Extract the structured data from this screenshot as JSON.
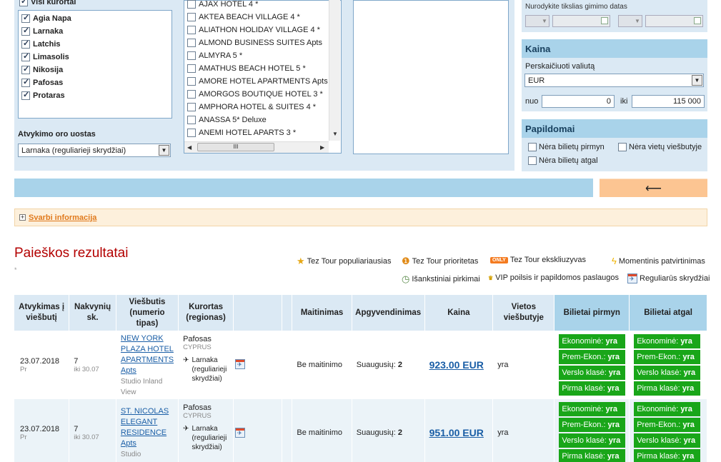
{
  "filters": {
    "all_resorts_label": "Visi kurortai",
    "resorts": [
      "Agia Napa",
      "Larnaka",
      "Latchis",
      "Limasolis",
      "Nikosija",
      "Pafosas",
      "Protaras"
    ],
    "airport_label": "Atvykimo oro uostas",
    "airport_value": "Larnaka (reguliarieji skrydžiai)",
    "hotels": [
      "AJAX HOTEL 4 *",
      "AKTEA BEACH VILLAGE 4 *",
      "ALIATHON HOLIDAY VILLAGE 4 *",
      "ALMOND BUSINESS SUITES Apts",
      "ALMYRA 5 *",
      "AMATHUS BEACH HOTEL 5 *",
      "AMORE HOTEL APARTMENTS Apts",
      "AMORGOS BOUTIQUE HOTEL 3 *",
      "AMPHORA HOTEL & SUITES 4 *",
      "ANASSA 5* Deluxe",
      "ANEMI HOTEL APARTS 3 *"
    ],
    "scroll_thumb": "III"
  },
  "right_panel": {
    "birth_label": "Nurodykite tikslias gimimo datas",
    "price_title": "Kaina",
    "currency_label": "Perskaičiuoti valiutą",
    "currency_value": "EUR",
    "from_label": "nuo",
    "from_value": "0",
    "to_label": "iki",
    "to_value": "115 000",
    "extra_title": "Papildomai",
    "extra_options": [
      "Nėra bilietų pirmyn",
      "Nėra vietų viešbutyje",
      "Nėra bilietų atgal"
    ]
  },
  "search_arrow": "⟵",
  "info": {
    "toggle": "+",
    "link": "Svarbi informacija"
  },
  "results": {
    "title": "Paieškos rezultatai",
    "star_note": "*",
    "legend": [
      {
        "icon": "star-medal-icon",
        "label": "Tez Tour populiariausias"
      },
      {
        "icon": "priority-medal-icon",
        "label": "Tez Tour prioritetas"
      },
      {
        "icon": "only-badge-icon",
        "label": "Tez Tour ekskliuzyvas"
      },
      {
        "icon": "lightning-icon",
        "label": "Momentinis patvirtinimas"
      },
      {
        "icon": "clock-icon",
        "label": "Išankstiniai pirkimai"
      },
      {
        "icon": "vip-icon",
        "label": "VIP poilsis ir papildomos paslaugos"
      },
      {
        "icon": "calendar-plane-icon",
        "label": "Reguliarūs skrydžiai"
      }
    ],
    "columns": [
      "Atvykimas į viešbutį",
      "Nakvynių sk.",
      "Viešbutis (numerio tipas)",
      "Kurortas (regionas)",
      "",
      "",
      "Maitinimas",
      "Apgyvendinimas",
      "Kaina",
      "Vietos viešbutyje",
      "Bilietai pirmyn",
      "Bilietai atgal"
    ],
    "rows": [
      {
        "date": "23.07.2018",
        "day": "Pr",
        "nights": "7",
        "until": "iki 30.07",
        "hotel": "NEW YORK PLAZA HOTEL APARTMENTS Apts",
        "room": "Studio Inland View",
        "resort": "Pafosas",
        "country": "CYPRUS",
        "transfer": "Larnaka (reguliarieji skrydžiai)",
        "meal": "Be maitinimo",
        "accommodation_label": "Suaugusių:",
        "accommodation_value": "2",
        "price": "923.00 EUR",
        "availability": "yra",
        "tickets_out": [
          {
            "cls": "Ekonominė:",
            "val": "yra"
          },
          {
            "cls": "Prem-Ekon.:",
            "val": "yra"
          },
          {
            "cls": "Verslo klasė:",
            "val": "yra"
          },
          {
            "cls": "Pirma klasė:",
            "val": "yra"
          }
        ],
        "tickets_back": [
          {
            "cls": "Ekonominė:",
            "val": "yra"
          },
          {
            "cls": "Prem-Ekon.:",
            "val": "yra"
          },
          {
            "cls": "Verslo klasė:",
            "val": "yra"
          },
          {
            "cls": "Pirma klasė:",
            "val": "yra"
          }
        ]
      },
      {
        "date": "23.07.2018",
        "day": "Pr",
        "nights": "7",
        "until": "iki 30.07",
        "hotel": "ST. NICOLAS ELEGANT RESIDENCE Apts",
        "room": "Studio",
        "resort": "Pafosas",
        "country": "CYPRUS",
        "transfer": "Larnaka (reguliarieji skrydžiai)",
        "meal": "Be maitinimo",
        "accommodation_label": "Suaugusių:",
        "accommodation_value": "2",
        "price": "951.00 EUR",
        "availability": "yra",
        "tickets_out": [
          {
            "cls": "Ekonominė:",
            "val": "yra"
          },
          {
            "cls": "Prem-Ekon.:",
            "val": "yra"
          },
          {
            "cls": "Verslo klasė:",
            "val": "yra"
          },
          {
            "cls": "Pirma klasė:",
            "val": "yra"
          }
        ],
        "tickets_back": [
          {
            "cls": "Ekonominė:",
            "val": "yra"
          },
          {
            "cls": "Prem-Ekon.:",
            "val": "yra"
          },
          {
            "cls": "Verslo klasė:",
            "val": "yra"
          },
          {
            "cls": "Pirma klasė:",
            "val": "yra"
          }
        ]
      }
    ]
  }
}
